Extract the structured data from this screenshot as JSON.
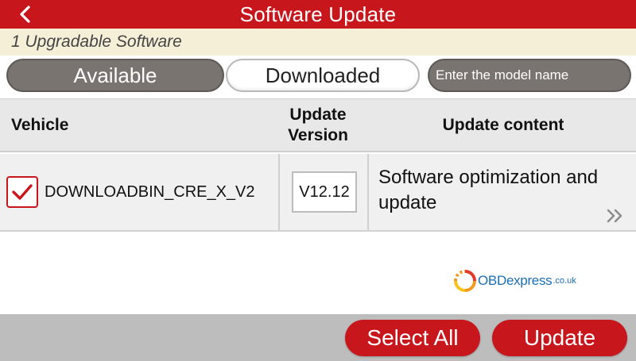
{
  "header": {
    "title": "Software Update",
    "background_color": "#c8161d",
    "back_icon": "chevron-left-icon"
  },
  "subbar": {
    "text": "1 Upgradable Software"
  },
  "tabs": [
    {
      "label": "Available",
      "selected": true
    },
    {
      "label": "Downloaded",
      "selected": false
    }
  ],
  "search": {
    "placeholder": "Enter the model name",
    "value": ""
  },
  "table": {
    "columns": [
      "Vehicle",
      "Update\nVersion",
      "Update content"
    ],
    "rows": [
      {
        "checked": true,
        "vehicle": "DOWNLOADBIN_CRE_X_V2",
        "version": "V12.12",
        "content": "Software optimization and update",
        "more_icon": "double-chevron-right-icon"
      }
    ]
  },
  "watermark": {
    "main": "OBDexpress",
    "suffix": ".co.uk"
  },
  "footer": {
    "select_all_label": "Select All",
    "update_label": "Update"
  },
  "colors": {
    "accent": "#c8161d",
    "tab_selected": "#7a7471",
    "subbar": "#f5efd8"
  }
}
